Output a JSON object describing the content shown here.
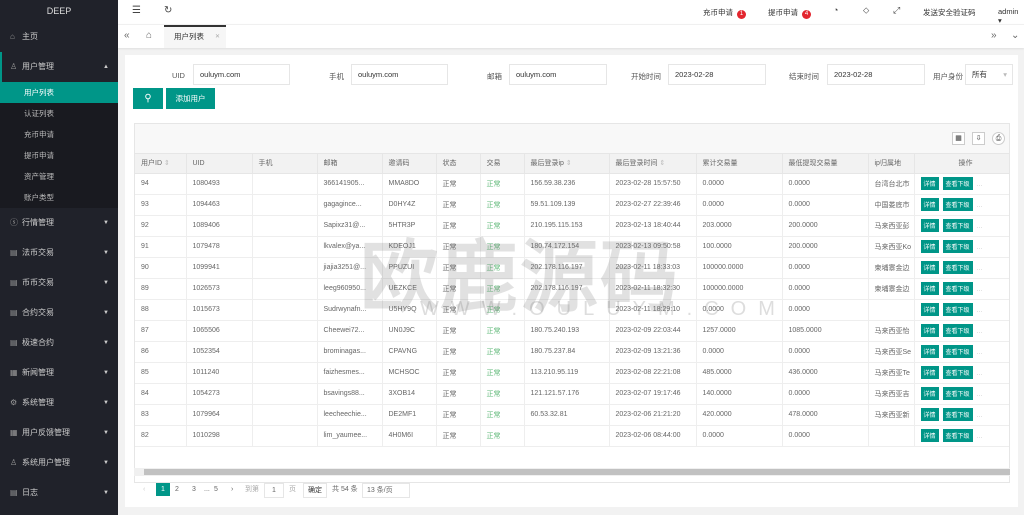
{
  "sidebar": {
    "logo": "DEEP",
    "home": "主页",
    "user_mgmt": "用户管理",
    "sub": [
      "用户列表",
      "认证列表",
      "充币申请",
      "提币申请",
      "资产管理",
      "账户类型"
    ],
    "groups": [
      "行情管理",
      "法币交易",
      "币币交易",
      "合约交易",
      "极速合约",
      "新闻管理",
      "系统管理",
      "用户反馈管理",
      "系统用户管理",
      "日志"
    ]
  },
  "topbar": {
    "deposit": "充币申请",
    "deposit_count": "1",
    "withdraw": "提币申请",
    "withdraw_count": "4",
    "send_code": "发送安全验证码",
    "user": "admin"
  },
  "tabs": {
    "active": "用户列表"
  },
  "filters": {
    "uid_label": "UID",
    "uid": "ouluym.com",
    "phone_label": "手机",
    "phone": "ouluym.com",
    "email_label": "邮箱",
    "email": "ouluym.com",
    "start_label": "开始时间",
    "start": "2023-02-28",
    "end_label": "结束时间",
    "end": "2023-02-28",
    "role_label": "用户身份",
    "role": "所有",
    "add_user": "添加用户"
  },
  "table": {
    "headers": [
      "用户ID",
      "UID",
      "手机",
      "邮箱",
      "邀请码",
      "状态",
      "交易",
      "最后登录ip",
      "最后登录时间",
      "累计交易量",
      "最低提现交易量",
      "ip归属地",
      "操作"
    ],
    "detail_btn": "详情",
    "sub_btn": "查看下级",
    "more": "...",
    "rows": [
      [
        "94",
        "1080493",
        "",
        "366141905...",
        "MMA8DO",
        "正常",
        "正常",
        "156.59.38.236",
        "2023-02-28 15:57:50",
        "0.0000",
        "0.0000",
        "台湾台北市"
      ],
      [
        "93",
        "1094463",
        "",
        "gagagince...",
        "D0HY4Z",
        "正常",
        "正常",
        "59.51.109.139",
        "2023-02-27 22:39:46",
        "0.0000",
        "0.0000",
        "中国娄底市"
      ],
      [
        "92",
        "1089406",
        "",
        "Sapixz31@...",
        "5HTR3P",
        "正常",
        "正常",
        "210.195.115.153",
        "2023-02-13 18:40:44",
        "203.0000",
        "200.0000",
        "马来西亚彭"
      ],
      [
        "91",
        "1079478",
        "",
        "lkvalex@ya...",
        "KDEOJ1",
        "正常",
        "正常",
        "180.74.172.154",
        "2023-02-13 09:50:58",
        "100.0000",
        "200.0000",
        "马来西亚Ko"
      ],
      [
        "90",
        "1099941",
        "",
        "jiajia3251@...",
        "PPUZUI",
        "正常",
        "正常",
        "202.178.116.197",
        "2023-02-11 18:33:03",
        "100000.0000",
        "0.0000",
        "柬埔寨金边"
      ],
      [
        "89",
        "1026573",
        "",
        "leeg960950...",
        "UEZKCE",
        "正常",
        "正常",
        "202.178.116.197",
        "2023-02-11 18:32:30",
        "100000.0000",
        "0.0000",
        "柬埔寨金边"
      ],
      [
        "88",
        "1015673",
        "",
        "Sudrwynafn...",
        "U5HY9Q",
        "正常",
        "正常",
        "",
        "2023-02-11 18:29:10",
        "0.0000",
        "0.0000",
        ""
      ],
      [
        "87",
        "1065506",
        "",
        "Cheewei72...",
        "UN0J9C",
        "正常",
        "正常",
        "180.75.240.193",
        "2023-02-09 22:03:44",
        "1257.0000",
        "1085.0000",
        "马来西亚怡"
      ],
      [
        "86",
        "1052354",
        "",
        "brominagas...",
        "CPAVNG",
        "正常",
        "正常",
        "180.75.237.84",
        "2023-02-09 13:21:36",
        "0.0000",
        "0.0000",
        "马来西亚Se"
      ],
      [
        "85",
        "1011240",
        "",
        "faizhesmes...",
        "MCHSOC",
        "正常",
        "正常",
        "113.210.95.119",
        "2023-02-08 22:21:08",
        "485.0000",
        "436.0000",
        "马来西亚Te"
      ],
      [
        "84",
        "1054273",
        "",
        "bsavings88...",
        "3XOB14",
        "正常",
        "正常",
        "121.121.57.176",
        "2023-02-07 19:17:46",
        "140.0000",
        "0.0000",
        "马来西亚吉"
      ],
      [
        "83",
        "1079964",
        "",
        "leecheechie...",
        "DE2MF1",
        "正常",
        "正常",
        "60.53.32.81",
        "2023-02-06 21:21:20",
        "420.0000",
        "478.0000",
        "马来西亚新"
      ],
      [
        "82",
        "1010298",
        "",
        "lim_yaumee...",
        "4H0M6I",
        "正常",
        "正常",
        "",
        "2023-02-06 08:44:00",
        "0.0000",
        "0.0000",
        ""
      ]
    ]
  },
  "pagination": {
    "pages": [
      "1",
      "2",
      "3",
      "...",
      "5"
    ],
    "goto": "到第",
    "goto_value": "1",
    "page_unit": "页",
    "confirm": "确定",
    "total": "共 54 条",
    "per_page": "13 条/页"
  },
  "watermark": {
    "text": "欧鹿源码",
    "url": "WWW.OULUYM.COM"
  }
}
